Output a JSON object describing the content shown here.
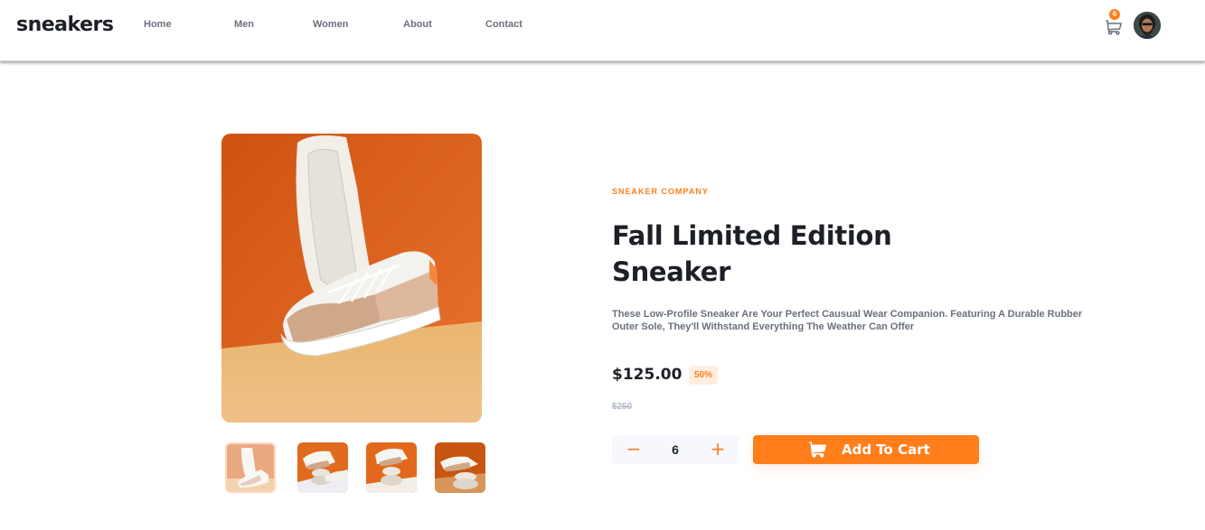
{
  "header": {
    "logo": "sneakers",
    "nav": [
      {
        "label": "Home"
      },
      {
        "label": "Men"
      },
      {
        "label": "Women"
      },
      {
        "label": "About"
      },
      {
        "label": "Contact"
      }
    ],
    "cart_count": "6",
    "cart_icon": "cart-icon",
    "avatar_icon": "avatar"
  },
  "product": {
    "company": "SNEAKER COMPANY",
    "title_line1": "Fall Limited Edition",
    "title_line2": "Sneaker",
    "description": "These Low-Profile Sneaker Are Your Perfect Causual Wear Companion. Featuring A Durable Rubber Outer Sole, They'll Withstand Everything The Weather Can Offer",
    "price": "$125.00",
    "discount": "50%",
    "old_price": "$250",
    "quantity": "6",
    "minus_label": "−",
    "plus_label": "+",
    "add_to_cart_label": "Add To Cart"
  },
  "colors": {
    "accent": "#ff7e1b",
    "accent_pale": "#ffede0",
    "dark_text": "#1d2026",
    "muted_text": "#69707d",
    "strike_text": "#b6bcc8"
  },
  "gallery": {
    "thumbnail_count": 4,
    "active_thumbnail": 1
  }
}
